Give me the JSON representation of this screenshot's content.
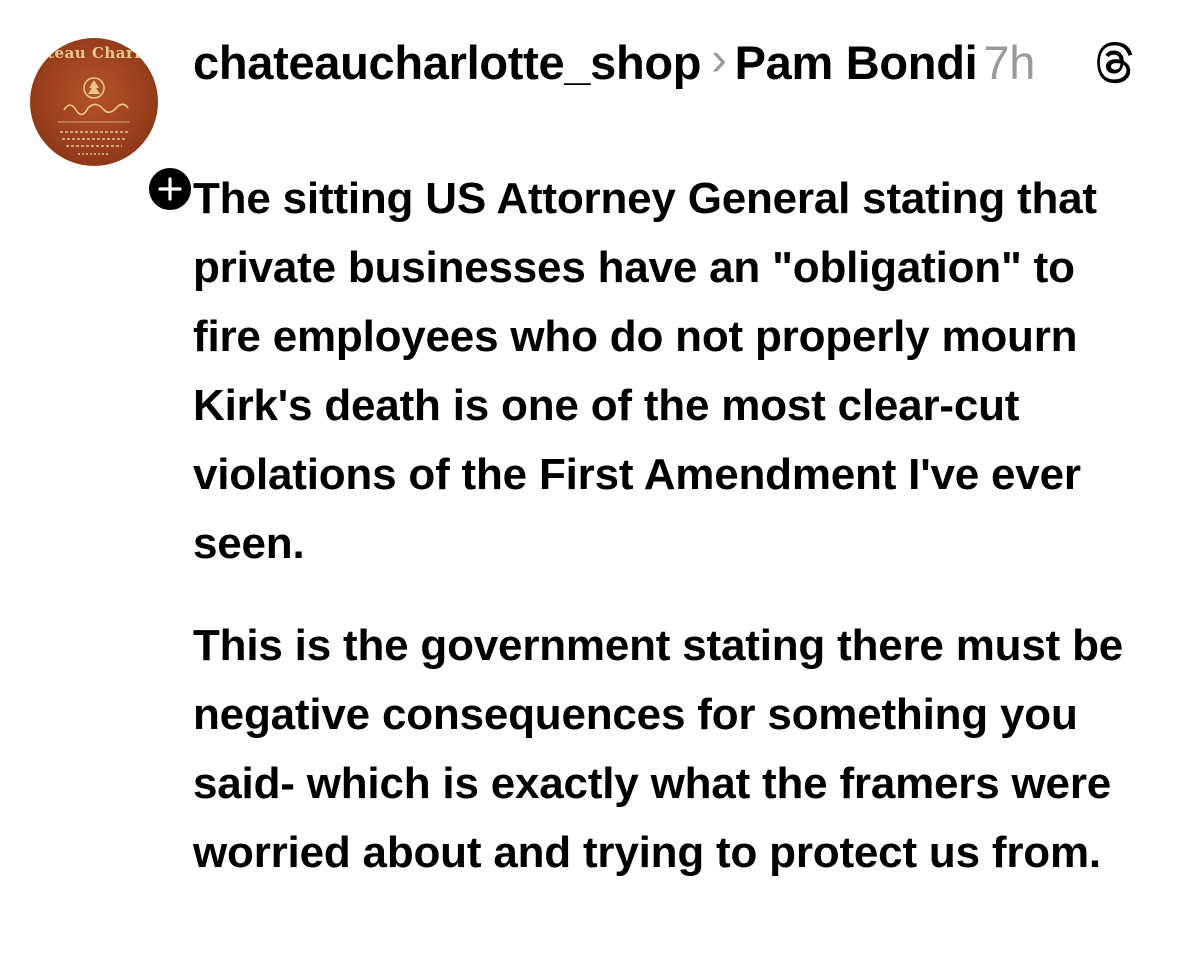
{
  "post": {
    "author": "chateaucharlotte_shop",
    "separator": "›",
    "reply_to": "Pam Bondi",
    "time": "7h",
    "avatar": {
      "logo_text": "ateau Charlo",
      "icon": "brand-logo"
    },
    "follow_icon": "plus-icon",
    "app_icon": "threads-icon",
    "paragraphs": [
      "The sitting US Attorney General stating that private businesses have an \"obligation\" to fire employees who do not properly mourn Kirk's death is one of the most clear-cut violations of the First Amendment I've ever seen.",
      "This is the government stating there must be negative consequences for something you said- which is exactly what the framers were worried about and trying to protect us from."
    ]
  },
  "colors": {
    "text": "#000000",
    "muted": "#9a9a9a",
    "avatar_bg": "#9a3f1c",
    "avatar_accent": "#e9c98a"
  }
}
